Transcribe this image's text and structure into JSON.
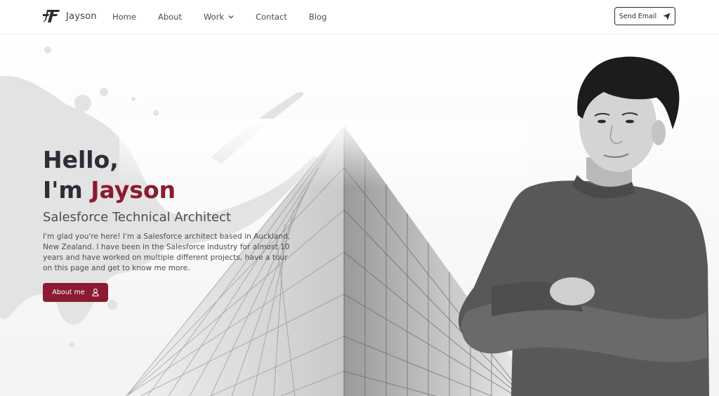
{
  "header": {
    "brand": "Jayson",
    "nav": {
      "home": "Home",
      "about": "About",
      "work": "Work",
      "contact": "Contact",
      "blog": "Blog"
    },
    "send_email": "Send Email"
  },
  "hero": {
    "greeting": "Hello,",
    "im_prefix": "I'm ",
    "name": "Jayson",
    "role": "Salesforce Technical Architect",
    "bio": "I'm glad you're here! I'm a Salesforce architect based in Auckland, New Zealand. I have been in the Salesforce industry for almost 10 years and have worked on multiple different projects, have a tour on this page and get to know me more.",
    "about_button": "About me"
  },
  "colors": {
    "accent": "#8b1a33",
    "text_dark": "#2b2e36",
    "text_muted": "#4a4d55"
  },
  "icons": {
    "logo": "jf-logo-icon",
    "work_dropdown": "chevron-down-icon",
    "send_email": "paper-plane-icon",
    "about_me": "user-icon"
  }
}
